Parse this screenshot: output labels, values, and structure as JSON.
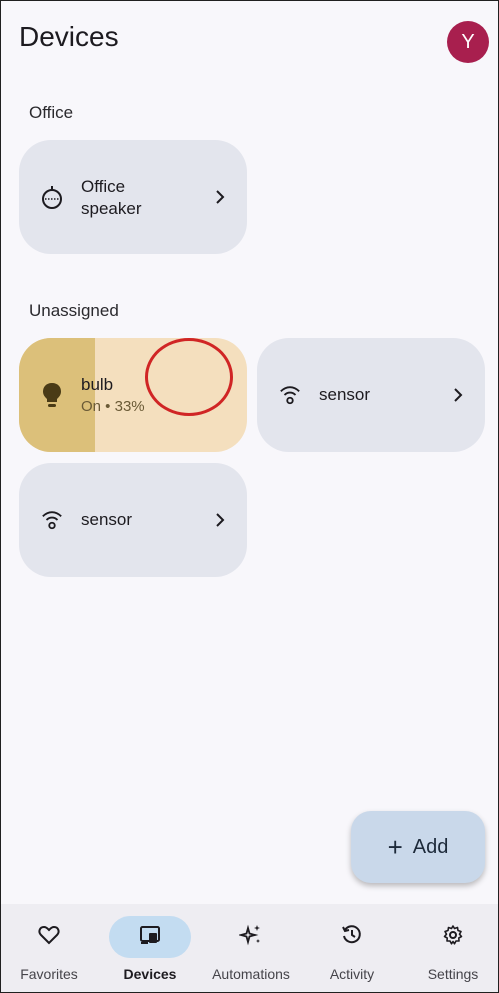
{
  "header": {
    "title": "Devices",
    "avatar_initial": "Y"
  },
  "sections": [
    {
      "label": "Office",
      "devices": [
        {
          "icon": "speaker-icon",
          "name_line1": "Office",
          "name_line2": "speaker"
        }
      ]
    },
    {
      "label": "Unassigned",
      "devices": [
        {
          "icon": "lightbulb-icon",
          "name": "bulb",
          "status": "On • 33%",
          "brightness_percent": 33,
          "state": "on"
        },
        {
          "icon": "wifi-sensor-icon",
          "name": "sensor"
        },
        {
          "icon": "wifi-sensor-icon",
          "name": "sensor"
        }
      ]
    }
  ],
  "fab": {
    "icon": "plus-icon",
    "label": "Add"
  },
  "bottom_nav": [
    {
      "icon": "heart-icon",
      "label": "Favorites",
      "active": false
    },
    {
      "icon": "devices-icon",
      "label": "Devices",
      "active": true
    },
    {
      "icon": "sparkle-icon",
      "label": "Automations",
      "active": false
    },
    {
      "icon": "history-icon",
      "label": "Activity",
      "active": false
    },
    {
      "icon": "gear-icon",
      "label": "Settings",
      "active": false
    }
  ],
  "colors": {
    "avatar": "#a81f4e",
    "card": "#e3e5ed",
    "bulb_card": "#f4dfbe",
    "bulb_fill": "#dcc07a",
    "fab": "#c9d8ea",
    "nav_active": "#c3dcf1",
    "touch_indicator": "#d02525"
  }
}
